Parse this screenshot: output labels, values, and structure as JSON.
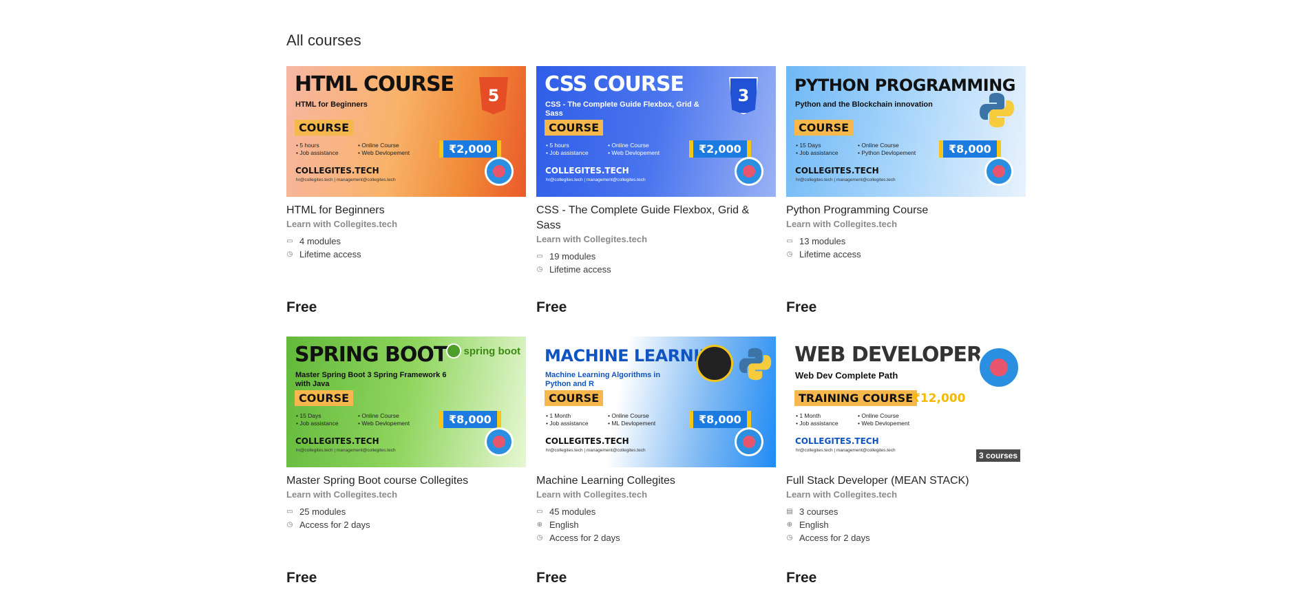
{
  "page": {
    "section_title": "All courses"
  },
  "colors": {
    "accent_blue": "#1c7be0",
    "tag_orange": "#f6b74d",
    "price_yellow": "#f5c518",
    "muted_text": "#8a8a8a"
  },
  "courses": [
    {
      "thumb": {
        "headline": "HTML COURSE",
        "subtitle": "HTML for Beginners",
        "tag": "COURSE",
        "bullets": [
          "5 hours",
          "Online Course",
          "Job assistance",
          "Web Devlopement"
        ],
        "price": "₹2,000",
        "brand": "COLLEGITES.TECH",
        "emails": "hr@collegites.tech | management@collegites.tech",
        "icon_label": "5",
        "logo": "collegites-logo-icon"
      },
      "title": "HTML for Beginners",
      "author": "Learn with Collegites.tech",
      "meta": [
        {
          "icon": "book-icon",
          "glyph": "▭",
          "text": "4 modules"
        },
        {
          "icon": "clock-icon",
          "glyph": "◷",
          "text": "Lifetime access"
        }
      ],
      "price": "Free"
    },
    {
      "thumb": {
        "headline": "CSS COURSE",
        "subtitle": "CSS - The Complete Guide Flexbox, Grid & Sass",
        "tag": "COURSE",
        "bullets": [
          "5 hours",
          "Online Course",
          "Job assistance",
          "Web Devlopement"
        ],
        "price": "₹2,000",
        "brand": "COLLEGITES.TECH",
        "emails": "hr@collegites.tech | management@collegites.tech",
        "icon_label": "3",
        "icon_caption": "CSS",
        "logo": "collegites-logo-icon"
      },
      "title": "CSS - The Complete Guide Flexbox, Grid & Sass",
      "author": "Learn with Collegites.tech",
      "meta": [
        {
          "icon": "book-icon",
          "glyph": "▭",
          "text": "19 modules"
        },
        {
          "icon": "clock-icon",
          "glyph": "◷",
          "text": "Lifetime access"
        }
      ],
      "price": "Free"
    },
    {
      "thumb": {
        "headline": "PYTHON PROGRAMMING",
        "subtitle": "Python and the Blockchain innovation",
        "tag": "COURSE",
        "bullets": [
          "15 Days",
          "Online Course",
          "Job assistance",
          "Python Devlopement"
        ],
        "price": "₹8,000",
        "brand": "COLLEGITES.TECH",
        "emails": "hr@collegites.tech | management@collegites.tech",
        "logo": "collegites-logo-icon"
      },
      "title": "Python Programming Course",
      "author": "Learn with Collegites.tech",
      "meta": [
        {
          "icon": "book-icon",
          "glyph": "▭",
          "text": "13 modules"
        },
        {
          "icon": "clock-icon",
          "glyph": "◷",
          "text": "Lifetime access"
        }
      ],
      "price": "Free"
    },
    {
      "thumb": {
        "headline": "SPRING BOOT",
        "subtitle": "Master Spring Boot 3 Spring Framework 6 with Java",
        "tag": "COURSE",
        "bullets": [
          "15 Days",
          "Online Course",
          "Job assistance",
          "Web Devlopement"
        ],
        "price": "₹8,000",
        "brand": "COLLEGITES.TECH",
        "emails": "hr@collegites.tech | management@collegites.tech",
        "icon_text": "spring boot",
        "logo": "collegites-logo-icon"
      },
      "title": "Master Spring Boot course Collegites",
      "author": "Learn with Collegites.tech",
      "meta": [
        {
          "icon": "book-icon",
          "glyph": "▭",
          "text": "25 modules"
        },
        {
          "icon": "clock-icon",
          "glyph": "◷",
          "text": "Access for 2 days"
        }
      ],
      "price": "Free"
    },
    {
      "thumb": {
        "headline": "MACHINE LEARNING",
        "subtitle": "Machine Learning Algorithms in Python and R",
        "tag": "COURSE",
        "bullets": [
          "1 Month",
          "Online Course",
          "Job assistance",
          "ML Devlopement"
        ],
        "price": "₹8,000",
        "brand": "COLLEGITES.TECH",
        "emails": "hr@collegites.tech | management@collegites.tech",
        "logo": "collegites-logo-icon"
      },
      "title": "Machine Learning Collegites",
      "author": "Learn with Collegites.tech",
      "meta": [
        {
          "icon": "book-icon",
          "glyph": "▭",
          "text": "45 modules"
        },
        {
          "icon": "globe-icon",
          "glyph": "⊕",
          "text": "English"
        },
        {
          "icon": "clock-icon",
          "glyph": "◷",
          "text": "Access for 2 days"
        }
      ],
      "price": "Free"
    },
    {
      "thumb": {
        "headline": "WEB DEVELOPER",
        "subtitle": "Web Dev Complete Path",
        "tag": "TRAINING COURSE",
        "bullets": [
          "1 Month",
          "Online Course",
          "Job assistance",
          "Web Devlopement"
        ],
        "price": "₹12,000",
        "brand": "COLLEGITES.TECH",
        "emails": "hr@collegites.tech | management@collegites.tech",
        "overlay": "3 courses",
        "logo": "collegites-logo-icon"
      },
      "title": "Full Stack Developer (MEAN STACK)",
      "author": "Learn with Collegites.tech",
      "meta": [
        {
          "icon": "bundle-icon",
          "glyph": "▤",
          "text": "3 courses"
        },
        {
          "icon": "globe-icon",
          "glyph": "⊕",
          "text": "English"
        },
        {
          "icon": "clock-icon",
          "glyph": "◷",
          "text": "Access for 2 days"
        }
      ],
      "price": "Free"
    }
  ]
}
